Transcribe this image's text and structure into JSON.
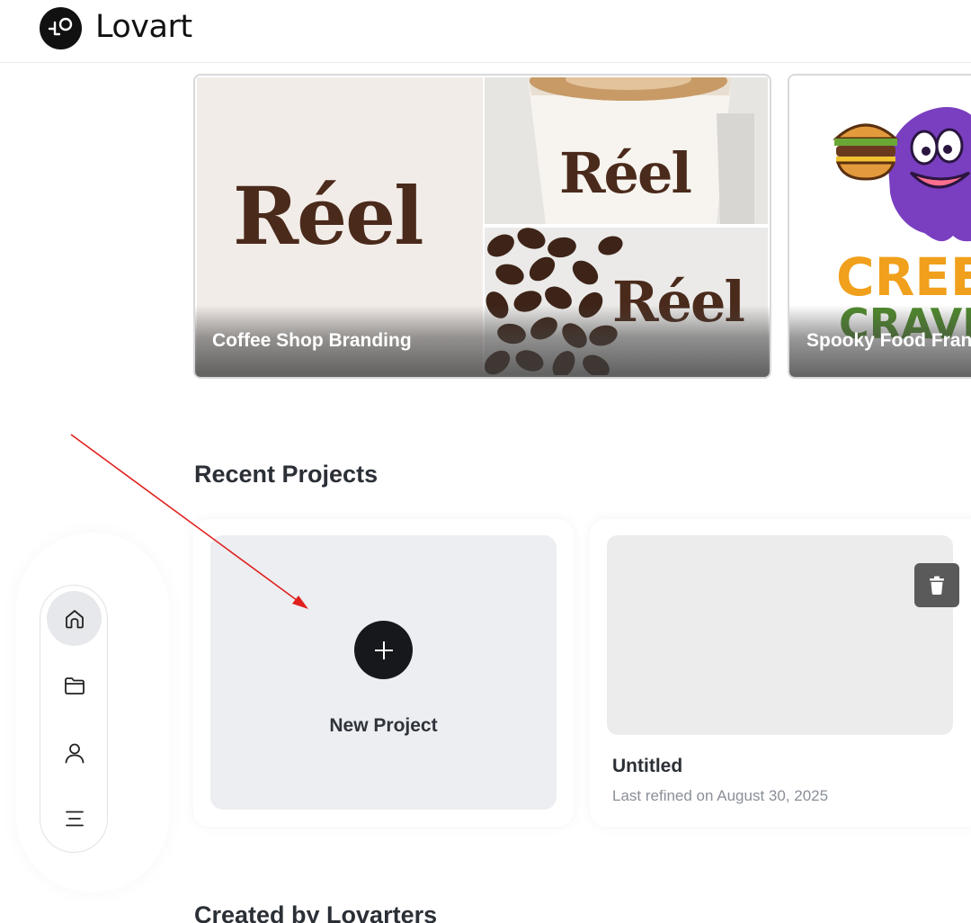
{
  "app": {
    "name": "Lovart"
  },
  "featured": [
    {
      "title": "Coffee Shop Branding",
      "brand_text": "Réel"
    },
    {
      "title": "Spooky Food Franchise",
      "visible_title": "Spooky Food Fran",
      "brand_text_line1": "CREEP",
      "brand_text_line2": "CRAVIN"
    }
  ],
  "sections": {
    "recent": "Recent Projects",
    "created": "Created by Lovarters"
  },
  "projects": {
    "new_label": "New Project",
    "items": [
      {
        "name": "Untitled",
        "meta": "Last refined on August 30, 2025"
      }
    ]
  },
  "nav": {
    "items": [
      {
        "icon": "home-icon",
        "active": true
      },
      {
        "icon": "folder-icon",
        "active": false
      },
      {
        "icon": "user-icon",
        "active": false
      },
      {
        "icon": "menu-icon",
        "active": false
      }
    ]
  },
  "colors": {
    "annotation_arrow": "#e0201d",
    "brand_brown": "#4a2a1b",
    "spooky_orange": "#f0a01c",
    "spooky_green": "#4f8a2c",
    "spooky_purple": "#7a3fc0"
  }
}
